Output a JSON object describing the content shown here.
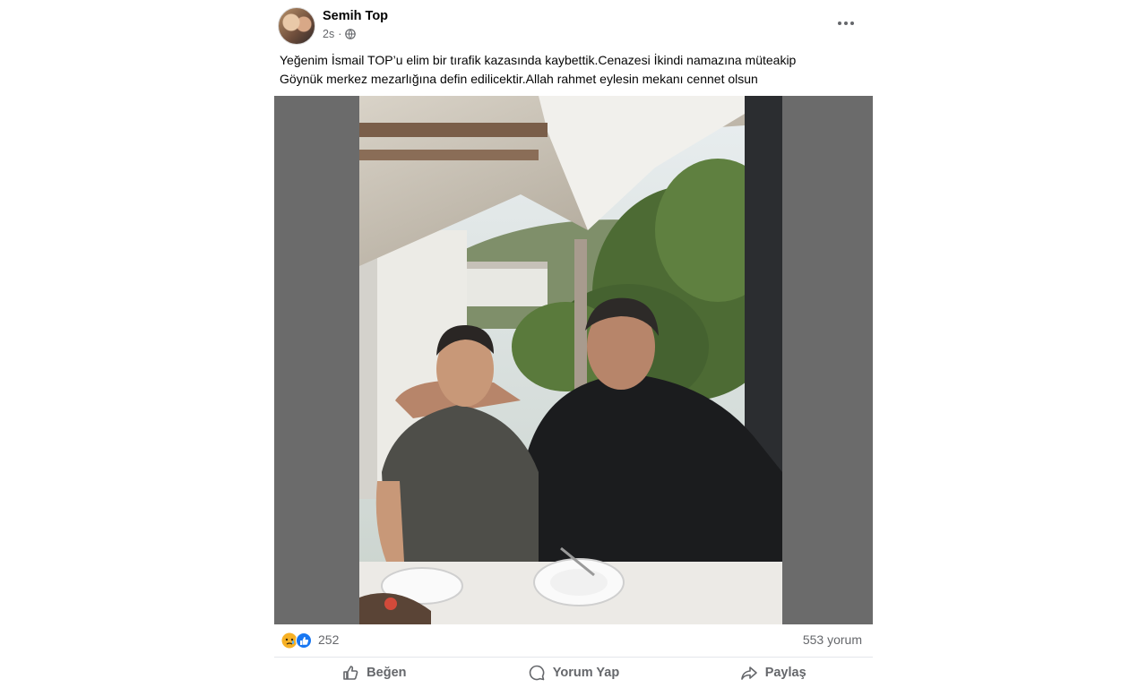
{
  "post": {
    "author": "Semih Top",
    "time": "2s",
    "separator": "·",
    "caption_line1": "Yeğenim İsmail TOP’u elim bir tırafik kazasında kaybettik.Cenazesi İkindi namazına müteakip",
    "caption_line2": "Göynük merkez mezarlığına defin edilicektir.Allah rahmet eylesin mekanı cennet olsun"
  },
  "stats": {
    "reactions_count": "252",
    "comments": "553 yorum"
  },
  "actions": {
    "like": "Beğen",
    "comment": "Yorum Yap",
    "share": "Paylaş"
  },
  "icons": [
    "globe-icon",
    "more-options-icon",
    "sad-reaction-icon",
    "like-reaction-icon",
    "like-icon",
    "comment-icon",
    "share-icon"
  ],
  "colors": {
    "accent": "#1877f2",
    "muted": "#65676b",
    "media_bg": "#6b6b6b"
  }
}
